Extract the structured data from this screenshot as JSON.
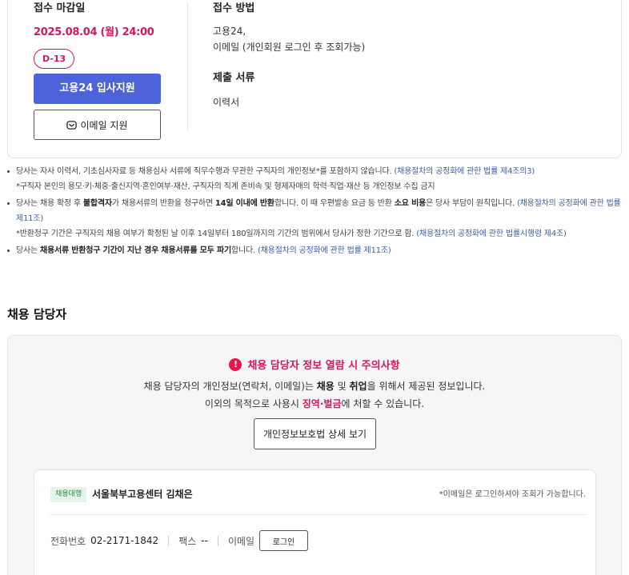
{
  "apply": {
    "deadline_label": "접수 마감일",
    "deadline_value": "2025.08.04 (월) 24:00",
    "dday": "D-13",
    "apply_button": "고용24 입사지원",
    "email_button": "이메일 지원",
    "method_label": "접수 방법",
    "method_lines": [
      "고용24,",
      "이메일 (개인회원 로그인 후 조회가능)"
    ],
    "docs_label": "제출 서류",
    "docs_value": "이력서"
  },
  "notices": [
    {
      "pre": "당사는 자사 이력서, 기초심사자료 등 채용심사 서류에 직무수행과 무관한 구직자의 개인정보*를 포함하지 않습니다. ",
      "law": "(채용절차의 공정화에 관한 법률 제4조의3)",
      "sub": "*구직자 본인의 용모·키·체중·출신지역·혼인여부·재산, 구직자의 직계 존비속 및 형제자매의 학력·직업·재산 등 개인정보 수집 금지"
    },
    {
      "t1": "당사는 채용 확정 후 ",
      "b1": "불합격자",
      "t2": "가 채용서류의 반환을 청구하면 ",
      "b2": "14일 이내에 반환",
      "t3": "합니다. 이 때 우편발송 요금 등 반환 ",
      "b3": "소요 비용",
      "t4": "은 당사 부담이 원칙입니다. ",
      "law": "(채용절차의 공정화에 관한 법률 제11조)",
      "sub": "*반환청구 기간은 구직자의 채용 여부가 확정된 날 이후 14일부터 180일까지의 기간의 범위에서 당사가 정한 기간으로 함. ",
      "sub_law": "(채용절차의 공정화에 관한 법률시행령 제4조)"
    },
    {
      "t1": "당사는 ",
      "b1": "채용서류 반환청구 기간이 지난 경우 채용서류를 모두 파기",
      "t2": "합니다. ",
      "law": "(채용절차의 공정화에 관한 법률 제11조)"
    }
  ],
  "contact": {
    "section_title": "채용 담당자",
    "warn_title": "채용 담당자 정보 열람 시 주의사항",
    "warn_icon": "!",
    "warn1_a": "채용 담당자의 개인정보(연락처, 이메일)는 ",
    "warn1_b": "채용",
    "warn1_c": " 및 ",
    "warn1_d": "취업",
    "warn1_e": "을 위해서 제공된 정보입니다.",
    "warn2_a": "이외의 목적으로 사용시 ",
    "warn2_b": "징역·벌금",
    "warn2_c": "에 처할 수 있습니다.",
    "privacy_button": "개인정보보호법 상세 보기",
    "tag": "채용대행",
    "org_name": "서울북부고용센터 김채은",
    "login_note": "*이메일은 로그인하셔야 조회가 가능합니다.",
    "phone_label": "전화번호",
    "phone_value": "02-2171-1842",
    "fax_label": "팩스",
    "fax_value": "--",
    "email_label": "이메일",
    "login_button": "로그인"
  },
  "colors": {
    "accent": "#4c63d9",
    "alert": "#d6165c",
    "law_link": "#3a5fa8",
    "tag_bg": "#e4f4e8"
  }
}
